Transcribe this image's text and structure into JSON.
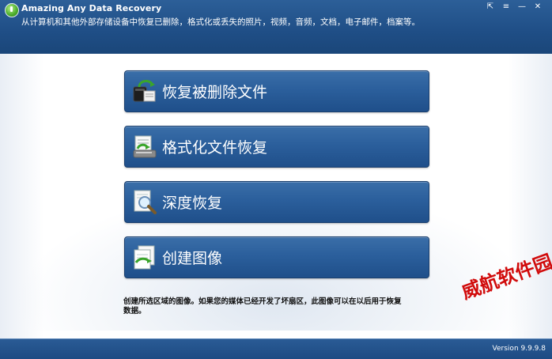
{
  "window": {
    "title": "Amazing Any Data Recovery",
    "subtitle": "从计算机和其他外部存储设备中恢复已删除，格式化或丢失的照片，视频，音频，文档，电子邮件，档案等。",
    "controls": [
      {
        "name": "share-icon",
        "glyph": "⇱"
      },
      {
        "name": "menu-icon",
        "glyph": "≡"
      },
      {
        "name": "minimize-icon",
        "glyph": "—"
      },
      {
        "name": "close-icon",
        "glyph": "✕"
      }
    ]
  },
  "actions": [
    {
      "label": "恢复被删除文件",
      "icon": "recycle-restore-icon"
    },
    {
      "label": "格式化文件恢复",
      "icon": "formatted-drive-icon"
    },
    {
      "label": "深度恢复",
      "icon": "deep-scan-magnifier-icon"
    },
    {
      "label": "创建图像",
      "icon": "create-image-icon"
    }
  ],
  "note": "创建所选区域的图像。如果您的媒体已经开发了坏扇区，此图像可以在以后用于恢复数据。",
  "watermark": "威航软件园",
  "footer": {
    "version": "Version 9.9.9.8"
  },
  "colors": {
    "header": "#1f4e86",
    "button": "#2b5f9c",
    "footer": "#1d4a82",
    "watermark": "#d10b0b"
  }
}
